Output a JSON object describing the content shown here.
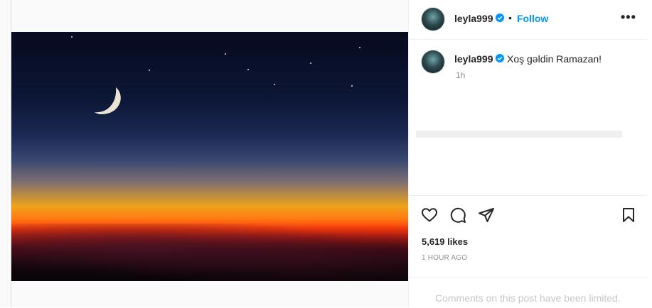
{
  "post": {
    "username": "leyla999",
    "follow_label": "Follow",
    "separator": "•",
    "more_label": "•••",
    "caption": "Xoş gəldin Ramazan!",
    "caption_time": "1h",
    "likes": "5,619 likes",
    "posted_ago": "1 HOUR AGO",
    "comments_notice": "Comments on this post have been limited."
  },
  "icons": {
    "verified": "verified-badge-icon",
    "like": "heart-icon",
    "comment": "comment-icon",
    "share": "paper-plane-icon",
    "save": "bookmark-icon"
  },
  "colors": {
    "accent": "#0095f6",
    "verified": "#0095f6",
    "muted": "#8e8e8e"
  }
}
